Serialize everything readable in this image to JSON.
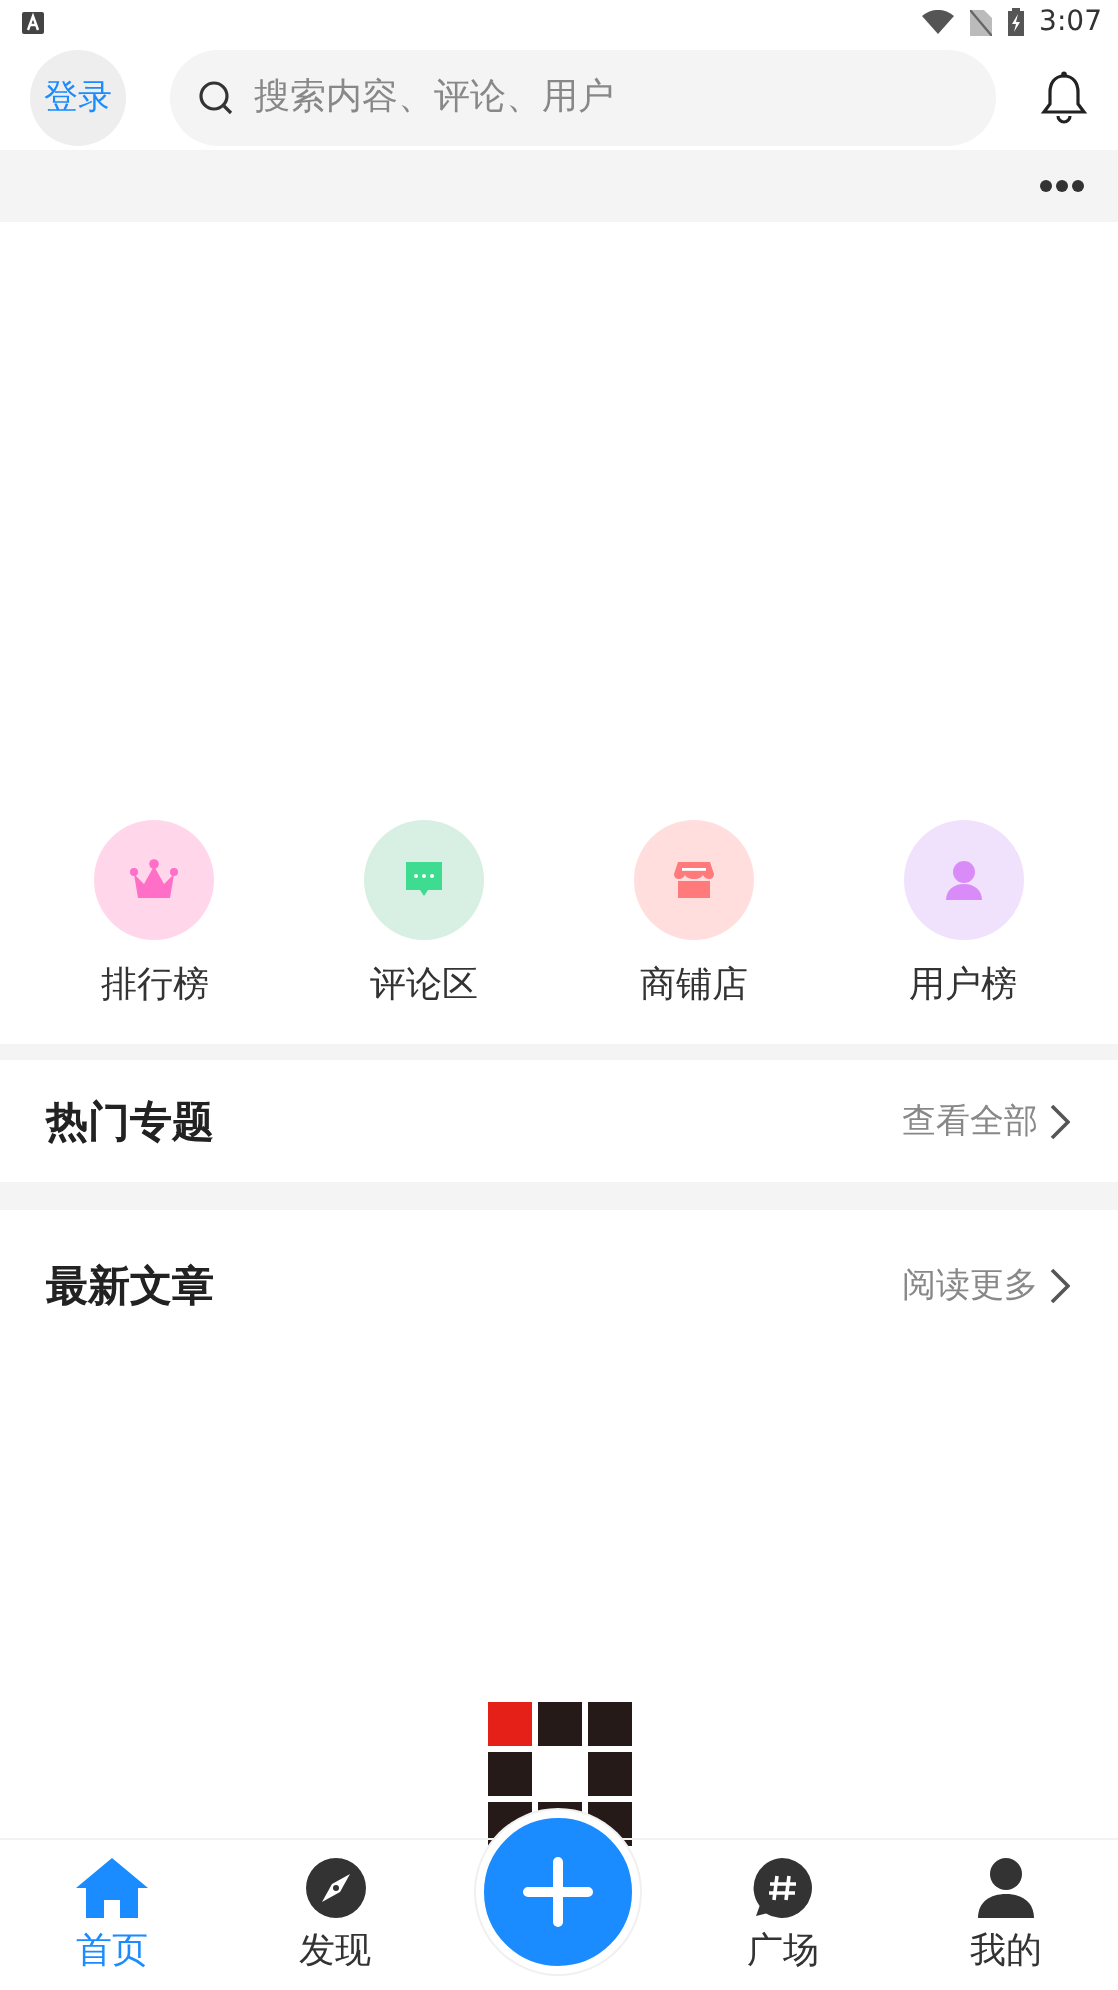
{
  "status_bar": {
    "time": "3:07"
  },
  "header": {
    "login_button": "登录",
    "search": {
      "placeholder": "搜索内容、评论、用户"
    }
  },
  "quick_links": [
    {
      "label": "排行榜",
      "kind": "crown",
      "color": "#ff6ec7"
    },
    {
      "label": "评论区",
      "kind": "chat",
      "color": "#3ddc91"
    },
    {
      "label": "商铺店",
      "kind": "shop",
      "color": "#ff7b7b"
    },
    {
      "label": "用户榜",
      "kind": "user",
      "color": "#d98cf7"
    }
  ],
  "sections": [
    {
      "title": "热门专题",
      "link": "查看全部"
    },
    {
      "title": "最新文章",
      "link": "阅读更多"
    }
  ],
  "tab_bar": [
    {
      "kind": "home",
      "label": "首页",
      "selected": true
    },
    {
      "kind": "compass",
      "label": "发现",
      "selected": false
    },
    {
      "kind": "add"
    },
    {
      "kind": "hash",
      "label": "广场",
      "selected": false
    },
    {
      "kind": "person",
      "label": "我的",
      "selected": false
    }
  ]
}
